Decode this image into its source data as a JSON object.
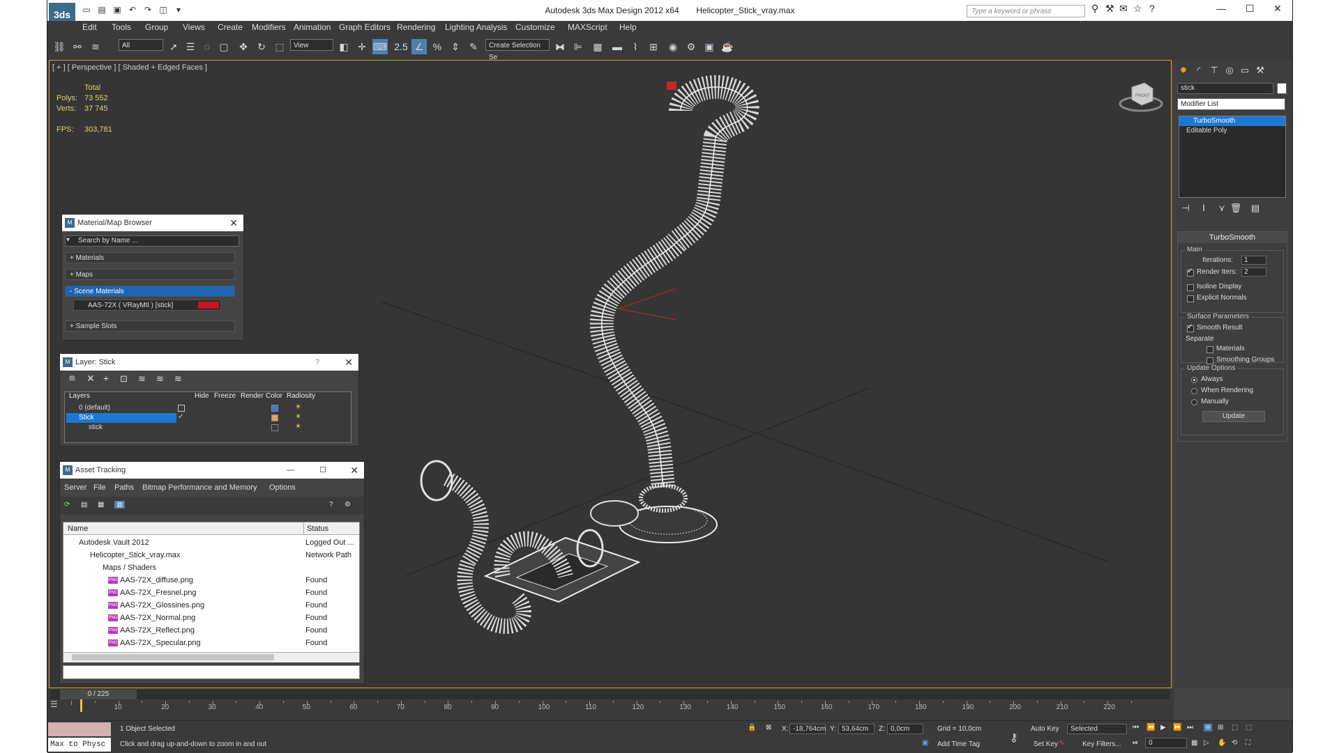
{
  "app": {
    "title": "Autodesk 3ds Max Design 2012 x64",
    "file": "Helicopter_Stick_vray.max",
    "logo_text": "3ds",
    "search_placeholder": "Type a keyword or phrase"
  },
  "menu": [
    "Edit",
    "Tools",
    "Group",
    "Views",
    "Create",
    "Modifiers",
    "Animation",
    "Graph Editors",
    "Rendering",
    "Lighting Analysis",
    "Customize",
    "MAXScript",
    "Help"
  ],
  "toolbar": {
    "selection_filter": "All",
    "ref_coord": "View",
    "snaps_value": "2.5",
    "named_selection": "Create Selection Se"
  },
  "viewport": {
    "label": "[ + ] [ Perspective ] [ Shaded + Edged Faces ]",
    "stats": {
      "total_label": "Total",
      "polys_label": "Polys:",
      "polys": "73 552",
      "verts_label": "Verts:",
      "verts": "37 745",
      "fps_label": "FPS:",
      "fps": "303,781"
    },
    "viewcube_label": "FRONT"
  },
  "command_panel": {
    "object_name": "stick",
    "modifier_list": "Modifier List",
    "stack": [
      "TurboSmooth",
      "Editable Poly"
    ],
    "rollout_title": "TurboSmooth",
    "main_label": "Main",
    "iterations_label": "Iterations:",
    "iterations": "1",
    "render_iters_label": "Render Iters:",
    "render_iters": "2",
    "isoline_label": "Isoline Display",
    "explicit_label": "Explicit Normals",
    "surface_label": "Surface Parameters",
    "smooth_result_label": "Smooth Result",
    "separate_label": "Separate",
    "materials_label": "Materials",
    "smoothing_groups_label": "Smoothing Groups",
    "update_options_label": "Update Options",
    "always_label": "Always",
    "when_rendering_label": "When Rendering",
    "manually_label": "Manually",
    "update_button": "Update"
  },
  "material_browser": {
    "title": "Material/Map Browser",
    "search_placeholder": "Search by Name ...",
    "sections": [
      "+ Materials",
      "+ Maps",
      "- Scene Materials"
    ],
    "scene_material": "AAS-72X ( VRayMtl ) [stick]",
    "sample_slots": "+ Sample Slots",
    "material_color": "#c8141e"
  },
  "layer_dialog": {
    "title": "Layer: Stick",
    "help": "?",
    "columns": [
      "Layers",
      "Hide",
      "Freeze",
      "Render",
      "Color",
      "Radiosity"
    ],
    "rows": [
      "0 (default)",
      "Stick",
      "stick"
    ],
    "layer_colors": [
      "#3a7bd5",
      "#e8a060",
      "#3a3a3a"
    ]
  },
  "asset_tracking": {
    "title": "Asset Tracking",
    "menus": [
      "Server",
      "File",
      "Paths",
      "Bitmap Performance and Memory",
      "Options"
    ],
    "columns": [
      "Name",
      "Status"
    ],
    "rows": [
      {
        "name": "Autodesk Vault 2012",
        "status": "Logged Out ..."
      },
      {
        "name": "Helicopter_Stick_vray.max",
        "status": "Network Path"
      },
      {
        "name": "Maps / Shaders",
        "status": ""
      },
      {
        "name": "AAS-72X_diffuse.png",
        "status": "Found"
      },
      {
        "name": "AAS-72X_Fresnel.png",
        "status": "Found"
      },
      {
        "name": "AAS-72X_Glossines.png",
        "status": "Found"
      },
      {
        "name": "AAS-72X_Normal.png",
        "status": "Found"
      },
      {
        "name": "AAS-72X_Reflect.png",
        "status": "Found"
      },
      {
        "name": "AAS-72X_Specular.png",
        "status": "Found"
      }
    ],
    "png_tag": "PNG"
  },
  "timeline": {
    "frame_counter": "0 / 225",
    "ticks": [
      "10",
      "20",
      "30",
      "40",
      "50",
      "60",
      "70",
      "80",
      "90",
      "100",
      "110",
      "120",
      "130",
      "140",
      "150",
      "160",
      "170",
      "180",
      "190",
      "200",
      "210",
      "220"
    ]
  },
  "status_bar": {
    "maxscript": "Max to Physc",
    "selection": "1 Object Selected",
    "prompt": "Click and drag up-and-down to zoom in and out",
    "x_label": "X:",
    "x": "-18,764cm",
    "y_label": "Y:",
    "y": "53,64cm",
    "z_label": "Z:",
    "z": "0,0cm",
    "grid": "Grid = 10,0cm",
    "add_time_tag": "Add Time Tag",
    "auto_key": "Auto Key",
    "selected": "Selected",
    "set_key": "Set Key",
    "key_filters": "Key Filters...",
    "frame": "0"
  }
}
